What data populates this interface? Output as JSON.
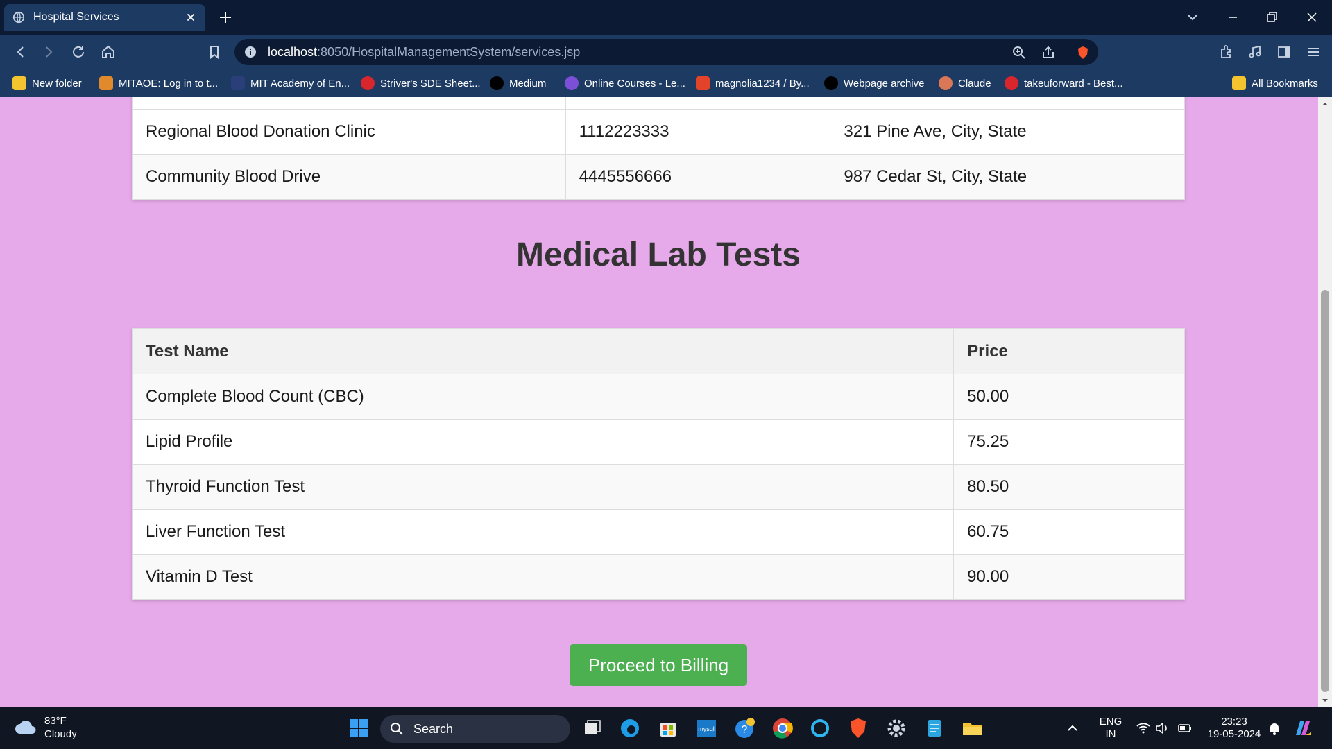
{
  "browser": {
    "tab_title": "Hospital Services",
    "url_host": "localhost",
    "url_path": ":8050/HospitalManagementSystem/services.jsp",
    "bookmarks": [
      "New folder",
      "MITAOE: Log in to t...",
      "MIT Academy of En...",
      "Striver's SDE Sheet...",
      "Medium",
      "Online Courses - Le...",
      "magnolia1234 / By...",
      "Webpage archive",
      "Claude",
      "takeuforward - Best..."
    ],
    "all_bookmarks": "All Bookmarks"
  },
  "blood_banks": {
    "rows": [
      [
        "Regional Blood Donation Clinic",
        "1112223333",
        "321 Pine Ave, City, State"
      ],
      [
        "Community Blood Drive",
        "4445556666",
        "987 Cedar St, City, State"
      ]
    ]
  },
  "lab_tests": {
    "heading": "Medical Lab Tests",
    "columns": [
      "Test Name",
      "Price"
    ],
    "rows": [
      [
        "Complete Blood Count (CBC)",
        "50.00"
      ],
      [
        "Lipid Profile",
        "75.25"
      ],
      [
        "Thyroid Function Test",
        "80.50"
      ],
      [
        "Liver Function Test",
        "60.75"
      ],
      [
        "Vitamin D Test",
        "90.00"
      ]
    ]
  },
  "billing_button": "Proceed to Billing",
  "taskbar": {
    "weather_temp": "83°F",
    "weather_desc": "Cloudy",
    "search_label": "Search",
    "lang_line1": "ENG",
    "lang_line2": "IN",
    "time": "23:23",
    "date": "19-05-2024"
  },
  "colors": {
    "page_bg": "#e6a9e9",
    "button": "#4caf50",
    "chrome_dark": "#0c1b33",
    "chrome": "#1d3a63"
  }
}
